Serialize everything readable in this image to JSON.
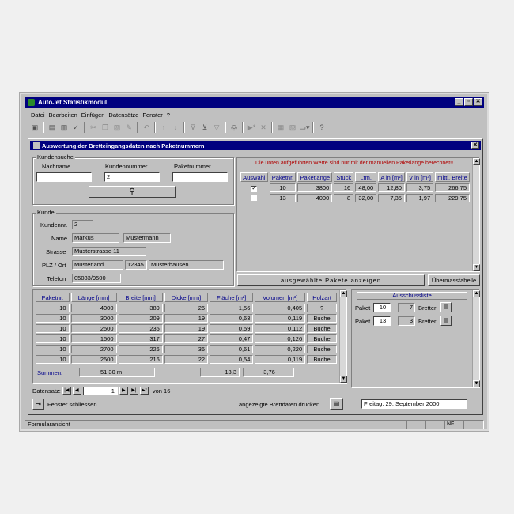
{
  "app": {
    "title": "AutoJet Statistikmodul",
    "controls": [
      "_",
      "▫",
      "✕"
    ]
  },
  "menu": [
    "Datei",
    "Bearbeiten",
    "Einfügen",
    "Datensätze",
    "Fenster",
    "?"
  ],
  "form": {
    "title": "Auswertung der Bretteingangsdaten nach Paketnummern",
    "close": "✕"
  },
  "kundensuche": {
    "group_label": "Kundensuche",
    "nachname_label": "Nachname",
    "kundennummer_label": "Kundennummer",
    "paketnummer_label": "Paketnummer",
    "nachname_value": "",
    "kundennummer_value": "2",
    "paketnummer_value": ""
  },
  "kunde": {
    "group_label": "Kunde",
    "kundennr_label": "Kundennr.",
    "kundennr": "2",
    "name_label": "Name",
    "vorname": "Markus",
    "nachname": "Mustermann",
    "strasse_label": "Strasse",
    "strasse": "Musterstrasse 11",
    "plz_label": "PLZ / Ort",
    "land": "Musterland",
    "plz": "12345",
    "ort": "Musterhausen",
    "telefon_label": "Telefon",
    "telefon": "05083/9500"
  },
  "notice": "Die unten aufgeführten Werte sind nur mit der manuellen Paketlänge berechnet!!",
  "paket_table": {
    "headers": [
      "Auswahl",
      "Paketnr.",
      "Paketlänge",
      "Stück",
      "Ltm.",
      "A in [m²]",
      "V in [m³]",
      "mittl. Breite"
    ],
    "rows": [
      {
        "auswahl": "✓",
        "paketnr": "10",
        "laenge": "3800",
        "stueck": "16",
        "ltm": "48,00",
        "a": "12,80",
        "v": "3,75",
        "breite": "266,75"
      },
      {
        "auswahl": "",
        "paketnr": "13",
        "laenge": "4000",
        "stueck": "8",
        "ltm": "32,00",
        "a": "7,35",
        "v": "1,97",
        "breite": "229,75"
      }
    ]
  },
  "buttons": {
    "anzeigen": "ausgewählte Pakete anzeigen",
    "uebermass": "Übermasstabelle",
    "fenster_schliessen": "Fenster schliessen",
    "drucken": "angezeigte Brettdaten drucken"
  },
  "brett_table": {
    "headers": [
      "Paketnr.",
      "Länge [mm]",
      "Breite [mm]",
      "Dicke [mm]",
      "Fläche [m²]",
      "Volumen [m³]",
      "Holzart"
    ],
    "rows": [
      {
        "paket": "10",
        "laenge": "4000",
        "breite": "389",
        "dicke": "26",
        "flaeche": "1,56",
        "volumen": "0,405",
        "holzart": "?"
      },
      {
        "paket": "10",
        "laenge": "3000",
        "breite": "209",
        "dicke": "19",
        "flaeche": "0,63",
        "volumen": "0,119",
        "holzart": "Buche"
      },
      {
        "paket": "10",
        "laenge": "2500",
        "breite": "235",
        "dicke": "19",
        "flaeche": "0,59",
        "volumen": "0,112",
        "holzart": "Buche"
      },
      {
        "paket": "10",
        "laenge": "1500",
        "breite": "317",
        "dicke": "27",
        "flaeche": "0,47",
        "volumen": "0,126",
        "holzart": "Buche"
      },
      {
        "paket": "10",
        "laenge": "2700",
        "breite": "226",
        "dicke": "36",
        "flaeche": "0,61",
        "volumen": "0,220",
        "holzart": "Buche"
      },
      {
        "paket": "10",
        "laenge": "2500",
        "breite": "216",
        "dicke": "22",
        "flaeche": "0,54",
        "volumen": "0,119",
        "holzart": "Buche"
      }
    ],
    "summen_label": "Summen:",
    "summen_laenge": "51,30 m",
    "summen_flaeche": "13,3",
    "summen_volumen": "3,76"
  },
  "navigation": {
    "label": "Datensatz:",
    "current": "1",
    "of_text": "von 16"
  },
  "ausschussliste": {
    "title": "Ausschussliste",
    "rows": [
      {
        "label": "Paket",
        "paket": "10",
        "count": "7",
        "unit": "Bretter"
      },
      {
        "label": "Paket",
        "paket": "13",
        "count": "3",
        "unit": "Bretter"
      }
    ]
  },
  "date_display": "Freitag, 29. September 2000",
  "statusbar": {
    "text": "Formularansicht",
    "num": "NF"
  }
}
